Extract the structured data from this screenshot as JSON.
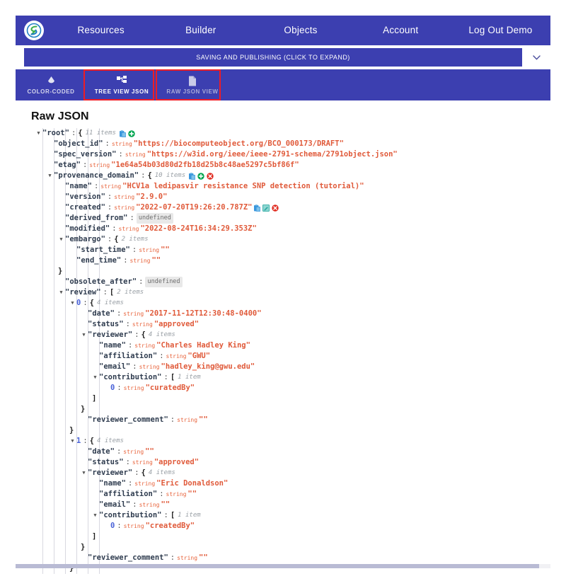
{
  "navbar": {
    "logo_icon": "biocompute-logo-icon",
    "links": [
      {
        "label": "Resources"
      },
      {
        "label": "Builder"
      },
      {
        "label": "Objects"
      },
      {
        "label": "Account"
      },
      {
        "label": "Log Out Demo"
      }
    ]
  },
  "savebar": {
    "label": "SAVING AND PUBLISHING (CLICK TO EXPAND)",
    "chevron_icon": "chevron-down-icon"
  },
  "tabs": [
    {
      "label": "COLOR-CODED",
      "icon": "droplet-icon",
      "state": "semi"
    },
    {
      "label": "TREE VIEW JSON",
      "icon": "tree-icon",
      "state": "active"
    },
    {
      "label": "RAW JSON VIEW",
      "icon": "document-icon",
      "state": "dim"
    }
  ],
  "highlights": [
    {
      "target": "TREE VIEW JSON",
      "color": "#ee1c25"
    },
    {
      "target": "RAW JSON VIEW",
      "color": "#ee1c25"
    }
  ],
  "main": {
    "title": "Raw JSON"
  },
  "colors": {
    "nav_blue": "#3c3fb0",
    "highlight_red": "#ee1c25",
    "string_value": "#e05a3a",
    "type_label": "#e8643c",
    "key": "#2f3c4f",
    "index": "#4a63d8",
    "icon_paste": "#3a96dd",
    "icon_add": "#00a651",
    "icon_delete": "#e02b20",
    "icon_edit": "#2aa8a0"
  },
  "tree": [
    {
      "depth": 0,
      "arrow": "down",
      "key": "\"root\"",
      "colon": ":",
      "brace": "{",
      "count": "11 items",
      "acts": [
        "paste-icon",
        "add-icon"
      ]
    },
    {
      "depth": 1,
      "key": "\"object_id\"",
      "colon": ":",
      "type": "string",
      "value": "\"https://biocomputeobject.org/BCO_000173/DRAFT\""
    },
    {
      "depth": 1,
      "key": "\"spec_version\"",
      "colon": ":",
      "type": "string",
      "value": "\"https://w3id.org/ieee/ieee-2791-schema/2791object.json\""
    },
    {
      "depth": 1,
      "key": "\"etag\"",
      "colon": ":",
      "type": "string",
      "value": "\"1e64a54b03d80d2fb18d25b8c48ae5297c5bf86f\""
    },
    {
      "depth": 1,
      "arrow": "down",
      "key": "\"provenance_domain\"",
      "colon": ":",
      "brace": "{",
      "count": "10 items",
      "acts": [
        "paste-icon",
        "add-icon",
        "delete-icon"
      ]
    },
    {
      "depth": 2,
      "key": "\"name\"",
      "colon": ":",
      "type": "string",
      "value": "\"HCV1a ledipasvir resistance SNP detection (tutorial)\""
    },
    {
      "depth": 2,
      "key": "\"version\"",
      "colon": ":",
      "type": "string",
      "value": "\"2.9.0\""
    },
    {
      "depth": 2,
      "key": "\"created\"",
      "colon": ":",
      "type": "string",
      "value": "\"2022-07-20T19:26:20.787Z\"",
      "acts": [
        "paste-icon",
        "edit-icon",
        "delete-icon"
      ]
    },
    {
      "depth": 2,
      "key": "\"derived_from\"",
      "colon": ":",
      "undefined": "undefined"
    },
    {
      "depth": 2,
      "key": "\"modified\"",
      "colon": ":",
      "type": "string",
      "value": "\"2022-08-24T16:34:29.353Z\""
    },
    {
      "depth": 2,
      "arrow": "down",
      "key": "\"embargo\"",
      "colon": ":",
      "brace": "{",
      "count": "2 items"
    },
    {
      "depth": 3,
      "key": "\"start_time\"",
      "colon": ":",
      "type": "string",
      "value": "\"\""
    },
    {
      "depth": 3,
      "key": "\"end_time\"",
      "colon": ":",
      "type": "string",
      "value": "\"\""
    },
    {
      "depth": 2,
      "close": "}"
    },
    {
      "depth": 2,
      "key": "\"obsolete_after\"",
      "colon": ":",
      "undefined": "undefined"
    },
    {
      "depth": 2,
      "arrow": "down",
      "key": "\"review\"",
      "colon": ":",
      "brace": "[",
      "count": "2 items"
    },
    {
      "depth": 3,
      "arrow": "down",
      "index": "0",
      "colon": ":",
      "brace": "{",
      "count": "4 items"
    },
    {
      "depth": 4,
      "key": "\"date\"",
      "colon": ":",
      "type": "string",
      "value": "\"2017-11-12T12:30:48-0400\""
    },
    {
      "depth": 4,
      "key": "\"status\"",
      "colon": ":",
      "type": "string",
      "value": "\"approved\""
    },
    {
      "depth": 4,
      "arrow": "down",
      "key": "\"reviewer\"",
      "colon": ":",
      "brace": "{",
      "count": "4 items"
    },
    {
      "depth": 5,
      "key": "\"name\"",
      "colon": ":",
      "type": "string",
      "value": "\"Charles Hadley King\""
    },
    {
      "depth": 5,
      "key": "\"affiliation\"",
      "colon": ":",
      "type": "string",
      "value": "\"GWU\""
    },
    {
      "depth": 5,
      "key": "\"email\"",
      "colon": ":",
      "type": "string",
      "value": "\"hadley_king@gwu.edu\""
    },
    {
      "depth": 5,
      "arrow": "down",
      "key": "\"contribution\"",
      "colon": ":",
      "brace": "[",
      "count": "1 item"
    },
    {
      "depth": 6,
      "index": "0",
      "colon": ":",
      "type": "string",
      "value": "\"curatedBy\""
    },
    {
      "depth": 5,
      "close": "]"
    },
    {
      "depth": 4,
      "close": "}"
    },
    {
      "depth": 4,
      "key": "\"reviewer_comment\"",
      "colon": ":",
      "type": "string",
      "value": "\"\""
    },
    {
      "depth": 3,
      "close": "}"
    },
    {
      "depth": 3,
      "arrow": "down",
      "index": "1",
      "colon": ":",
      "brace": "{",
      "count": "4 items"
    },
    {
      "depth": 4,
      "key": "\"date\"",
      "colon": ":",
      "type": "string",
      "value": "\"\""
    },
    {
      "depth": 4,
      "key": "\"status\"",
      "colon": ":",
      "type": "string",
      "value": "\"approved\""
    },
    {
      "depth": 4,
      "arrow": "down",
      "key": "\"reviewer\"",
      "colon": ":",
      "brace": "{",
      "count": "4 items"
    },
    {
      "depth": 5,
      "key": "\"name\"",
      "colon": ":",
      "type": "string",
      "value": "\"Eric Donaldson\""
    },
    {
      "depth": 5,
      "key": "\"affiliation\"",
      "colon": ":",
      "type": "string",
      "value": "\"\""
    },
    {
      "depth": 5,
      "key": "\"email\"",
      "colon": ":",
      "type": "string",
      "value": "\"\""
    },
    {
      "depth": 5,
      "arrow": "down",
      "key": "\"contribution\"",
      "colon": ":",
      "brace": "[",
      "count": "1 item"
    },
    {
      "depth": 6,
      "index": "0",
      "colon": ":",
      "type": "string",
      "value": "\"createdBy\""
    },
    {
      "depth": 5,
      "close": "]"
    },
    {
      "depth": 4,
      "close": "}"
    },
    {
      "depth": 4,
      "key": "\"reviewer_comment\"",
      "colon": ":",
      "type": "string",
      "value": "\"\""
    },
    {
      "depth": 3,
      "close": "}"
    }
  ]
}
